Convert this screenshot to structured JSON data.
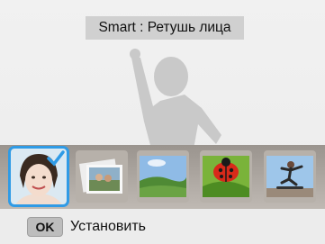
{
  "header": {
    "title": "Smart : Ретушь лица"
  },
  "thumbnails": [
    {
      "name": "Ретушь лица",
      "icon": "face-retouch-portrait-icon",
      "selected": true
    },
    {
      "name": "photo-stack",
      "icon": "photo-stack-icon",
      "selected": false
    },
    {
      "name": "landscape",
      "icon": "landscape-icon",
      "selected": false
    },
    {
      "name": "macro",
      "icon": "ladybug-macro-icon",
      "selected": false
    },
    {
      "name": "action",
      "icon": "skateboarder-action-icon",
      "selected": false
    }
  ],
  "footer": {
    "ok_key": "OK",
    "ok_label": "Установить"
  },
  "colors": {
    "selection": "#2f9be6",
    "strip": "#a9a39d",
    "title_bg": "#d0d0d0"
  }
}
